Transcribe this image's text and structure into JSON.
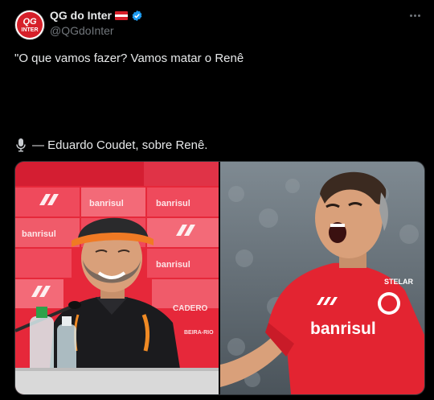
{
  "author": {
    "display_name": "QG do Inter",
    "handle": "@QGdoInter",
    "avatar_text_top": "QG",
    "avatar_text_bottom": "INTER"
  },
  "tweet": {
    "line1": "\"O que vamos fazer? Vamos matar o Renê",
    "line2": "— Eduardo Coudet, sobre Renê."
  },
  "media": {
    "left": {
      "backdrop_labels": [
        "banrisul",
        "banrisul",
        "banrisul",
        "banrisul",
        "CADERO",
        "BEIRA-RIO"
      ]
    },
    "right": {
      "shirt_sponsor": "banrisul",
      "shirt_brand": "STELAR"
    }
  },
  "colors": {
    "background": "#000000",
    "text": "#e7e9ea",
    "muted": "#71767b",
    "verified": "#1d9bf0",
    "inter_red": "#d6202a"
  },
  "icons": {
    "more": "ellipsis-icon",
    "verified": "verified-badge-icon",
    "flag": "flag-icon",
    "mic": "microphone-icon"
  }
}
